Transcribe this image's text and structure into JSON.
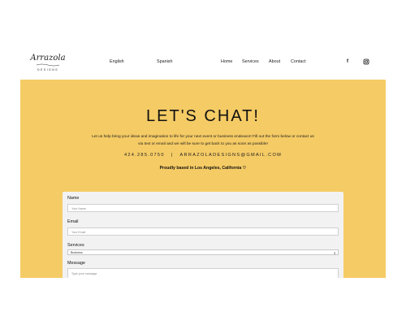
{
  "header": {
    "logo": {
      "script": "Arrazola",
      "sub": "DESIGNS"
    },
    "languages": [
      "English",
      "Spanish"
    ],
    "nav": [
      "Home",
      "Services",
      "About",
      "Contact"
    ],
    "social": [
      {
        "icon": "facebook-icon",
        "glyph": "f"
      },
      {
        "icon": "instagram-icon"
      }
    ]
  },
  "hero": {
    "background": "#f5cb65",
    "title": "LET'S CHAT!",
    "intro": "Let us help bring your ideas and imagination to life for your next event or business endeavor! Fill out the form below or contact us via text or email and we will be sure to get back to you as soon as possible!",
    "phone": "424.285.0750",
    "separator": "|",
    "email": "ARRAZOLADESIGNS@GMAIL.COM",
    "based": "Proudly based in Los Angeles, California ♡"
  },
  "form": {
    "name_label": "Name",
    "name_placeholder": "Your Name",
    "email_label": "Email",
    "email_placeholder": "Your Email",
    "services_label": "Services",
    "services_value": "Business",
    "message_label": "Message",
    "message_placeholder": "Type your message"
  }
}
